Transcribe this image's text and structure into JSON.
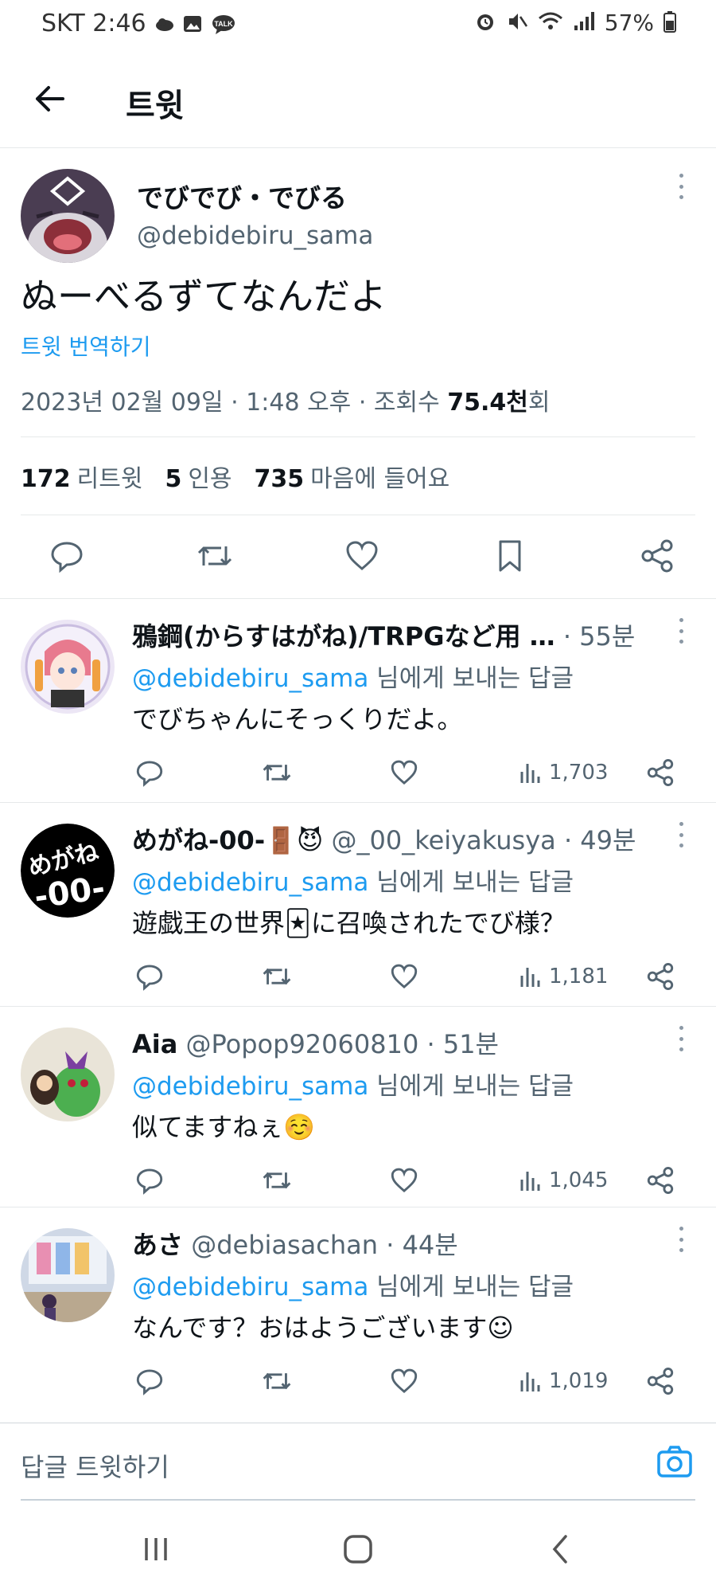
{
  "status_bar": {
    "carrier_time": "SKT 2:46",
    "battery": "57%"
  },
  "header": {
    "title": "트윗"
  },
  "tweet": {
    "author_name": "でびでび・でびる",
    "author_handle": "@debidebiru_sama",
    "text": "ぬーべるずてなんだよ",
    "translate": "트윗 번역하기",
    "timestamp": "2023년 02월 09일 · 1:48 오후 · 조회수 ",
    "views": "75.4천",
    "views_suffix": "회",
    "retweets": "172",
    "retweets_label": "리트윗",
    "quotes": "5",
    "quotes_label": "인용",
    "likes": "735",
    "likes_label": "마음에 들어요"
  },
  "replies": [
    {
      "name": "鴉鋼(からすはがね)/TRPGなど用 …",
      "handle": "",
      "time": " · 55분",
      "mention": "@debidebiru_sama",
      "replying_suffix": " 님에게 보내는 답글",
      "text": "でびちゃんにそっくりだよ。",
      "views": "1,703"
    },
    {
      "name": "めがね-00-🚪😈",
      "handle": " @_00_keiyakusya",
      "time": " · 49분",
      "mention": "@debidebiru_sama",
      "replying_suffix": " 님에게 보내는 답글",
      "text": "遊戯王の世界🃏に召喚されたでび様？",
      "views": "1,181"
    },
    {
      "name": "Aia",
      "handle": " @Popop92060810",
      "time": " · 51분",
      "mention": "@debidebiru_sama",
      "replying_suffix": " 님에게 보내는 답글",
      "text": "似てますねぇ☺️",
      "views": "1,045"
    },
    {
      "name": "あさ",
      "handle": " @debiasachan",
      "time": " · 44분",
      "mention": "@debidebiru_sama",
      "replying_suffix": " 님에게 보내는 답글",
      "text": "なんです？おはようございます☺",
      "views": "1,019"
    }
  ],
  "composer": {
    "placeholder": "답글 트윗하기"
  },
  "colors": {
    "accent": "#1d9bf0",
    "secondary_text": "#536471",
    "divider": "#e6e9ea"
  }
}
